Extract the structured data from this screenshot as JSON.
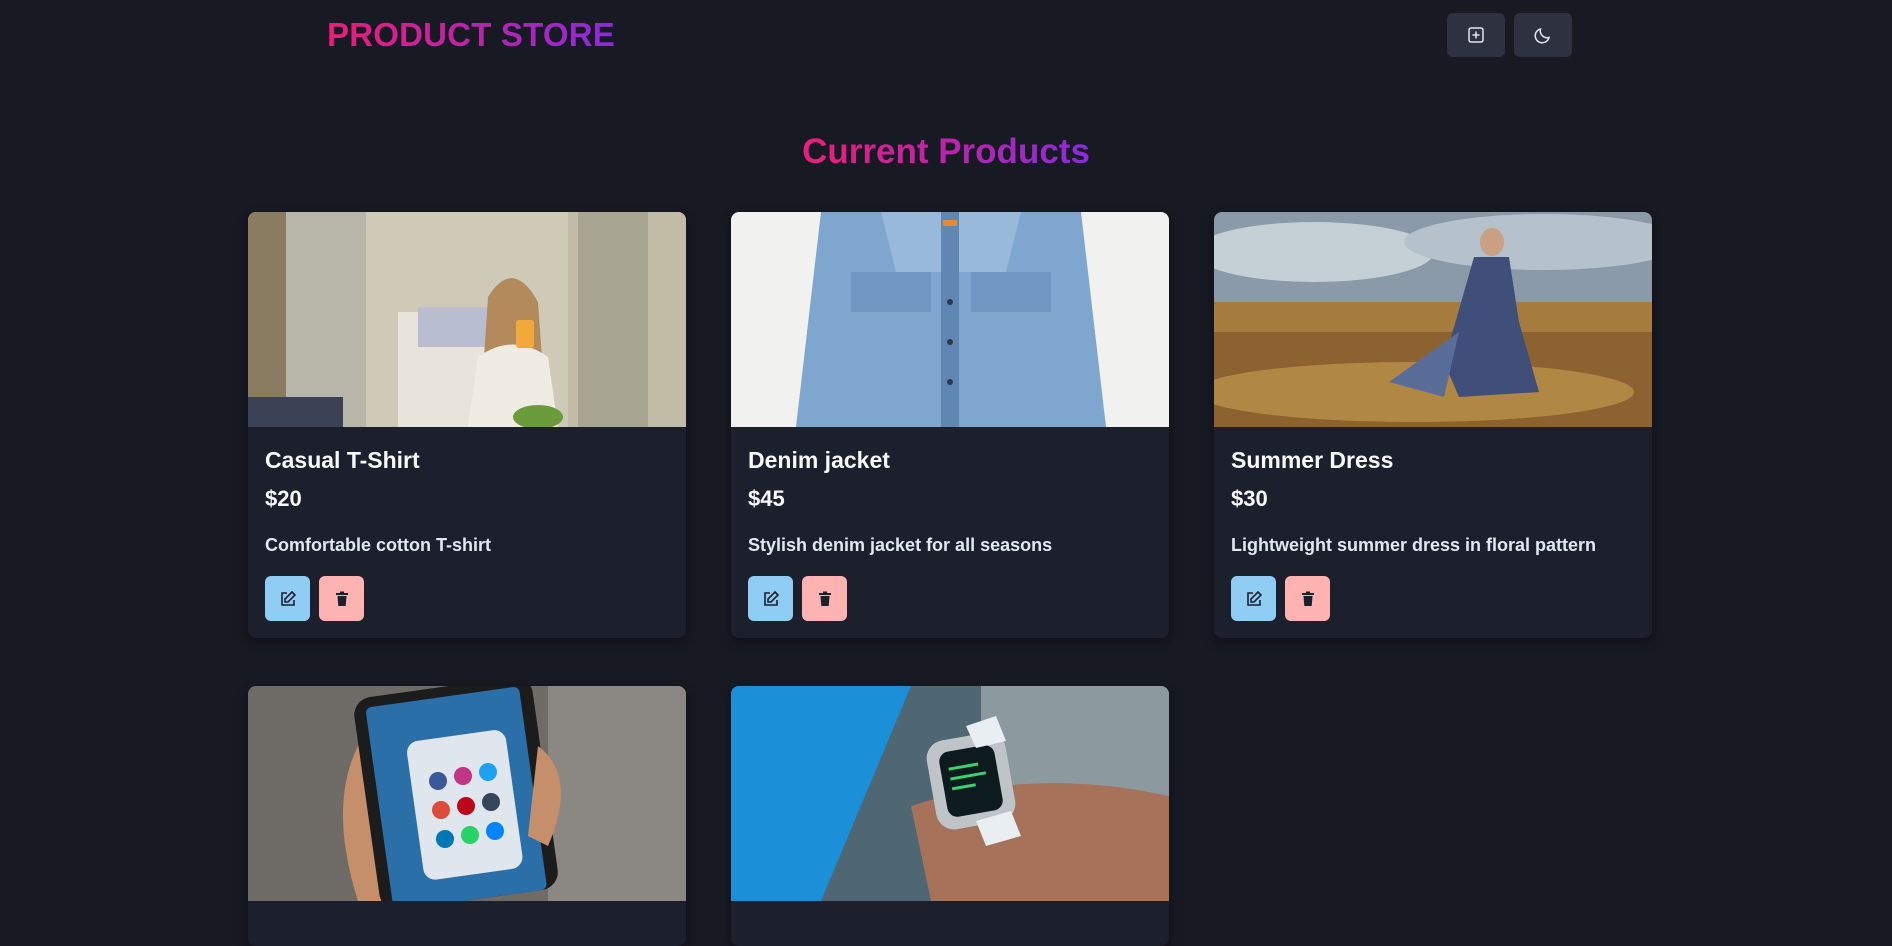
{
  "header": {
    "brand": "PRODUCT STORE",
    "create_icon": "plus-square-icon",
    "theme_icon": "moon-icon"
  },
  "main": {
    "title": "Current Products"
  },
  "products": [
    {
      "name": "Casual T-Shirt",
      "price": "$20",
      "description": "Comfortable cotton T-shirt"
    },
    {
      "name": "Denim jacket",
      "price": "$45",
      "description": "Stylish denim jacket for all seasons"
    },
    {
      "name": "Summer Dress",
      "price": "$30",
      "description": "Lightweight summer dress in floral pattern"
    },
    {
      "name": "",
      "price": "",
      "description": ""
    },
    {
      "name": "",
      "price": "",
      "description": ""
    }
  ],
  "colors": {
    "background": "#171923",
    "card": "#1c202d",
    "accent_start": "#ea1e78",
    "accent_end": "#8a2bdb",
    "edit_button": "#90cdf4",
    "delete_button": "#feb2b2"
  }
}
